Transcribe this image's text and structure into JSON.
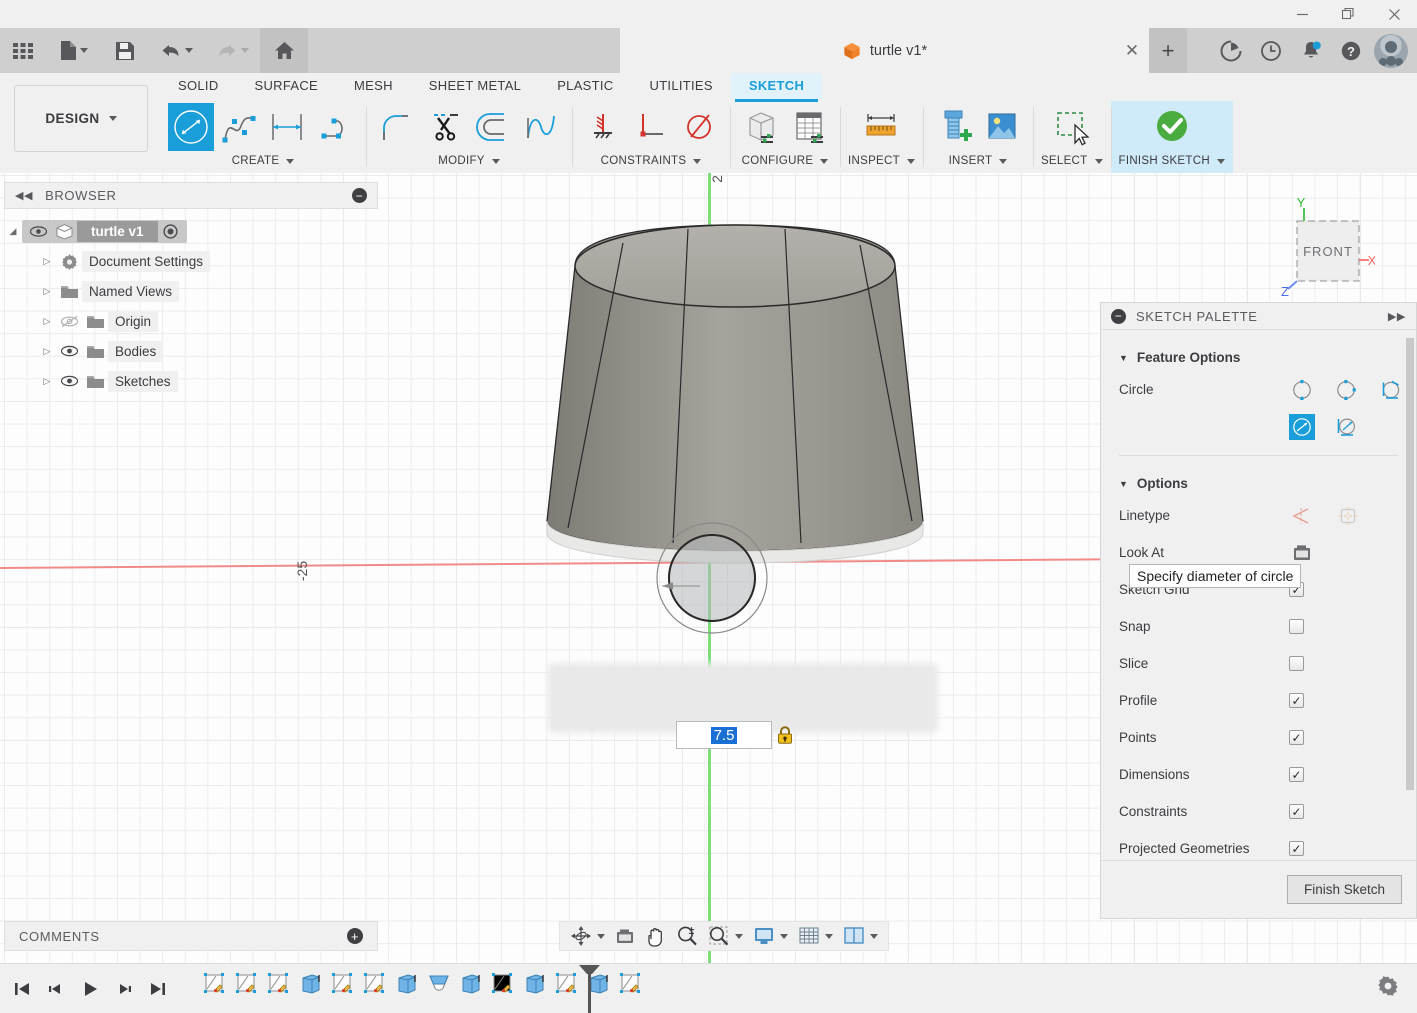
{
  "window": {
    "minimize_label": "—",
    "restore_label": "❐",
    "close_label": "✕"
  },
  "appbar": {
    "grid_icon": "apps-grid-icon",
    "new_label": "new-file-icon",
    "save_label": "save-icon",
    "undo_label": "undo-icon",
    "redo_label": "redo-icon",
    "home_label": "home-icon",
    "document_tab": "turtle v1*",
    "tab_close": "✕",
    "new_tab": "+",
    "icons": [
      "job-status-icon",
      "recent-icon",
      "notifications-icon",
      "help-icon",
      "account-avatar"
    ]
  },
  "ribbon": {
    "workspace": "DESIGN",
    "tabs": [
      {
        "label": "SOLID",
        "active": false
      },
      {
        "label": "SURFACE",
        "active": false
      },
      {
        "label": "MESH",
        "active": false
      },
      {
        "label": "SHEET METAL",
        "active": false
      },
      {
        "label": "PLASTIC",
        "active": false
      },
      {
        "label": "UTILITIES",
        "active": false
      },
      {
        "label": "SKETCH",
        "active": true
      }
    ],
    "groups": [
      {
        "label": "CREATE",
        "dropdown": true
      },
      {
        "label": "MODIFY",
        "dropdown": true
      },
      {
        "label": "CONSTRAINTS",
        "dropdown": true
      },
      {
        "label": "CONFIGURE",
        "dropdown": true
      },
      {
        "label": "INSPECT",
        "dropdown": true
      },
      {
        "label": "INSERT",
        "dropdown": true
      },
      {
        "label": "SELECT",
        "dropdown": true
      },
      {
        "label": "FINISH SKETCH",
        "dropdown": true
      }
    ]
  },
  "browser": {
    "title": "BROWSER",
    "collapse_icon": "◀◀",
    "minimize_icon": "−",
    "root": {
      "label": "turtle v1",
      "visible": true
    },
    "items": [
      {
        "label": "Document Settings",
        "icon": "gear-icon",
        "has_eye": false,
        "visible": true
      },
      {
        "label": "Named Views",
        "icon": "folder-icon",
        "has_eye": false,
        "visible": true
      },
      {
        "label": "Origin",
        "icon": "folder-icon",
        "has_eye": true,
        "visible": false
      },
      {
        "label": "Bodies",
        "icon": "folder-icon",
        "has_eye": true,
        "visible": true
      },
      {
        "label": "Sketches",
        "icon": "folder-icon",
        "has_eye": true,
        "visible": true
      }
    ]
  },
  "comments": {
    "title": "COMMENTS",
    "add_icon": "+"
  },
  "palette": {
    "title": "SKETCH PALETTE",
    "minimize_icon": "−",
    "expand_icon": "▶▶",
    "sections": [
      {
        "title": "Feature Options",
        "rows": [
          {
            "name": "Circle",
            "type": "icons"
          }
        ]
      },
      {
        "title": "Options",
        "rows": [
          {
            "name": "Linetype",
            "type": "icons"
          },
          {
            "name": "Look At",
            "type": "icon"
          },
          {
            "name": "Sketch Grid",
            "type": "check",
            "checked": true
          },
          {
            "name": "Snap",
            "type": "check",
            "checked": false
          },
          {
            "name": "Slice",
            "type": "check",
            "checked": false
          },
          {
            "name": "Profile",
            "type": "check",
            "checked": true
          },
          {
            "name": "Points",
            "type": "check",
            "checked": true
          },
          {
            "name": "Dimensions",
            "type": "check",
            "checked": true
          },
          {
            "name": "Constraints",
            "type": "check",
            "checked": true
          },
          {
            "name": "Projected Geometries",
            "type": "check",
            "checked": true
          }
        ]
      }
    ],
    "circle_modes": [
      "center-diameter-circle",
      "2-point-circle",
      "3-point-circle",
      "2-tangent-circle",
      "3-tangent-circle"
    ],
    "selected_circle_mode": "2-tangent-circle",
    "finish_button": "Finish Sketch"
  },
  "tooltip": {
    "text": "Specify diameter of circle"
  },
  "canvas": {
    "dimension_value": "7.5",
    "lock_icon": "locked-dimension-icon",
    "axis_label_left": "-25",
    "axis_label_top": "2",
    "viewcube_face": "FRONT",
    "viewcube_axes": {
      "x": "X",
      "y": "Y",
      "z": "Z"
    },
    "axis_x_color": "#f08b88",
    "axis_y_color": "#7ede7e"
  },
  "navbar": {
    "buttons": [
      {
        "name": "orbit-icon",
        "dropdown": true
      },
      {
        "name": "look-at-icon",
        "dropdown": false
      },
      {
        "name": "pan-icon",
        "dropdown": false
      },
      {
        "name": "zoom-icon",
        "dropdown": false
      },
      {
        "name": "zoom-window-icon",
        "dropdown": true
      },
      {
        "name": "display-settings-icon",
        "dropdown": true
      },
      {
        "name": "grid-snaps-icon",
        "dropdown": true
      },
      {
        "name": "viewports-icon",
        "dropdown": true
      }
    ]
  },
  "timeline": {
    "playback": [
      "go-to-start-icon",
      "step-back-icon",
      "play-icon",
      "step-forward-icon",
      "go-to-end-icon"
    ],
    "features": [
      {
        "type": "sketch"
      },
      {
        "type": "sketch"
      },
      {
        "type": "sketch"
      },
      {
        "type": "body"
      },
      {
        "type": "sketch"
      },
      {
        "type": "sketch"
      },
      {
        "type": "body"
      },
      {
        "type": "revolve"
      },
      {
        "type": "body"
      },
      {
        "type": "sketch"
      },
      {
        "type": "body"
      },
      {
        "type": "sketch"
      },
      {
        "type": "body"
      },
      {
        "type": "sketch"
      }
    ],
    "settings_icon": "gear-icon"
  },
  "colors": {
    "accent": "#1a9ed9",
    "accent_light": "#cfeaf8",
    "chrome": "#cfcfcf",
    "panel": "#f0f0f0",
    "selection": "#1a6fd4"
  }
}
